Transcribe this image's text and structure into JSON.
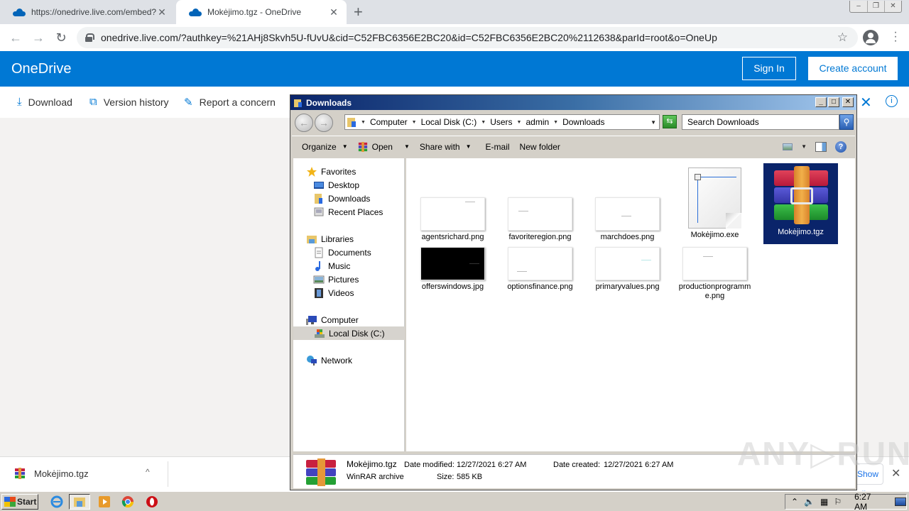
{
  "browser": {
    "tabs": [
      {
        "label": "https://onedrive.live.com/embed?cid",
        "icon": "onedrive-cloud-icon",
        "active": false
      },
      {
        "label": "Mokėjimo.tgz - OneDrive",
        "icon": "onedrive-cloud-icon",
        "active": true
      }
    ],
    "new_tab_label": "+",
    "url": "onedrive.live.com/?authkey=%21AHj8Skvh5U-fUvU&cid=C52FBC6356E2BC20&id=C52FBC6356E2BC20%2112638&parId=root&o=OneUp",
    "window_controls": {
      "minimize": "–",
      "restore": "❐",
      "close": "✕"
    }
  },
  "onedrive": {
    "brand": "OneDrive",
    "sign_in": "Sign In",
    "create_account": "Create account",
    "commands": [
      {
        "label": "Download",
        "icon": "download-icon",
        "glyph": "⤓"
      },
      {
        "label": "Version history",
        "icon": "version-history-icon",
        "glyph": "⧉"
      },
      {
        "label": "Report a concern",
        "icon": "report-icon",
        "glyph": "✎"
      }
    ],
    "close_glyph": "✕",
    "info_glyph": "i",
    "accent": "#0078d4"
  },
  "download_shelf": {
    "filename": "Mokėjimo.tgz",
    "chevron": "^",
    "show_all": "Show all",
    "close": "✕"
  },
  "explorer": {
    "title": "Downloads",
    "breadcrumb": [
      "Computer",
      "Local Disk (C:)",
      "Users",
      "admin",
      "Downloads"
    ],
    "search_placeholder": "Search Downloads",
    "toolbar": {
      "organize": "Organize",
      "open": "Open",
      "share_with": "Share with",
      "email": "E-mail",
      "new_folder": "New folder",
      "help": "?"
    },
    "nav": {
      "favorites": "Favorites",
      "favorites_items": [
        "Desktop",
        "Downloads",
        "Recent Places"
      ],
      "libraries": "Libraries",
      "libraries_items": [
        "Documents",
        "Music",
        "Pictures",
        "Videos"
      ],
      "computer": "Computer",
      "computer_items": [
        "Local Disk (C:)"
      ],
      "network": "Network"
    },
    "files": [
      {
        "name": "agentsrichard.png",
        "type": "image"
      },
      {
        "name": "favoriteregion.png",
        "type": "image"
      },
      {
        "name": "marchdoes.png",
        "type": "image"
      },
      {
        "name": "Mokėjimo.exe",
        "type": "exe"
      },
      {
        "name": "Mokėjimo.tgz",
        "type": "rar",
        "selected": true
      },
      {
        "name": "offerswindows.jpg",
        "type": "image-dark"
      },
      {
        "name": "optionsfinance.png",
        "type": "image"
      },
      {
        "name": "primaryvalues.png",
        "type": "image"
      },
      {
        "name": "productionprogramme.png",
        "type": "image"
      }
    ],
    "details": {
      "name": "Mokėjimo.tgz",
      "type": "WinRAR archive",
      "modified_label": "Date modified:",
      "modified": "12/27/2021 6:27 AM",
      "created_label": "Date created:",
      "created": "12/27/2021 6:27 AM",
      "size_label": "Size:",
      "size": "585 KB"
    }
  },
  "watermark": "ANY▷RUN",
  "taskbar": {
    "start": "Start",
    "clock": "6:27 AM",
    "tray_icons": [
      "show-hidden-icon",
      "volume-icon",
      "network-icon",
      "action-center-flag-icon"
    ]
  }
}
